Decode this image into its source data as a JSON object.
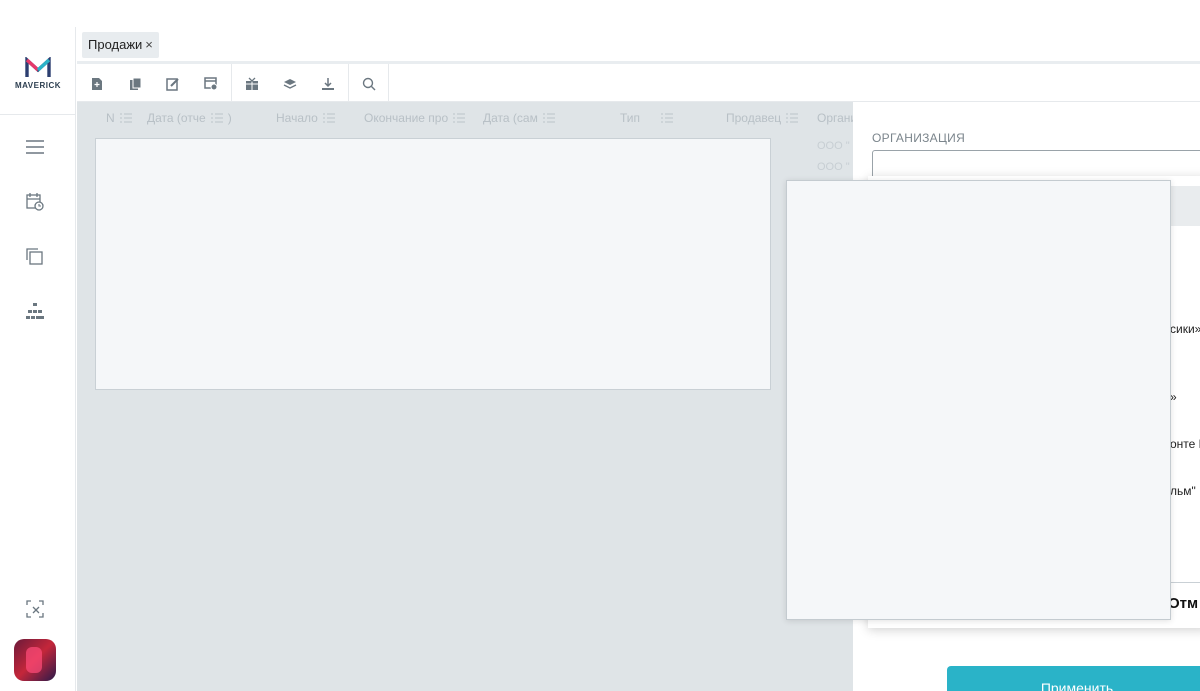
{
  "app": {
    "brand": "MAVERICK"
  },
  "tabs": [
    {
      "label": "Продажи",
      "close": "×"
    }
  ],
  "grid": {
    "columns": [
      "N",
      "Дата (отче",
      ")",
      "Начало",
      "Окончание про",
      "Дата (сам",
      "Тип",
      "Продавец",
      "Органи"
    ],
    "org_cells": [
      "ООО \"",
      "ООО \""
    ]
  },
  "filter_panel": {
    "org_label": "ОРГАНИЗАЦИЯ",
    "dropdown_items": [
      "сики»",
      "»",
      "онте И",
      "льм\""
    ],
    "cancel_label": "Отм",
    "apply_label": "Применить"
  }
}
